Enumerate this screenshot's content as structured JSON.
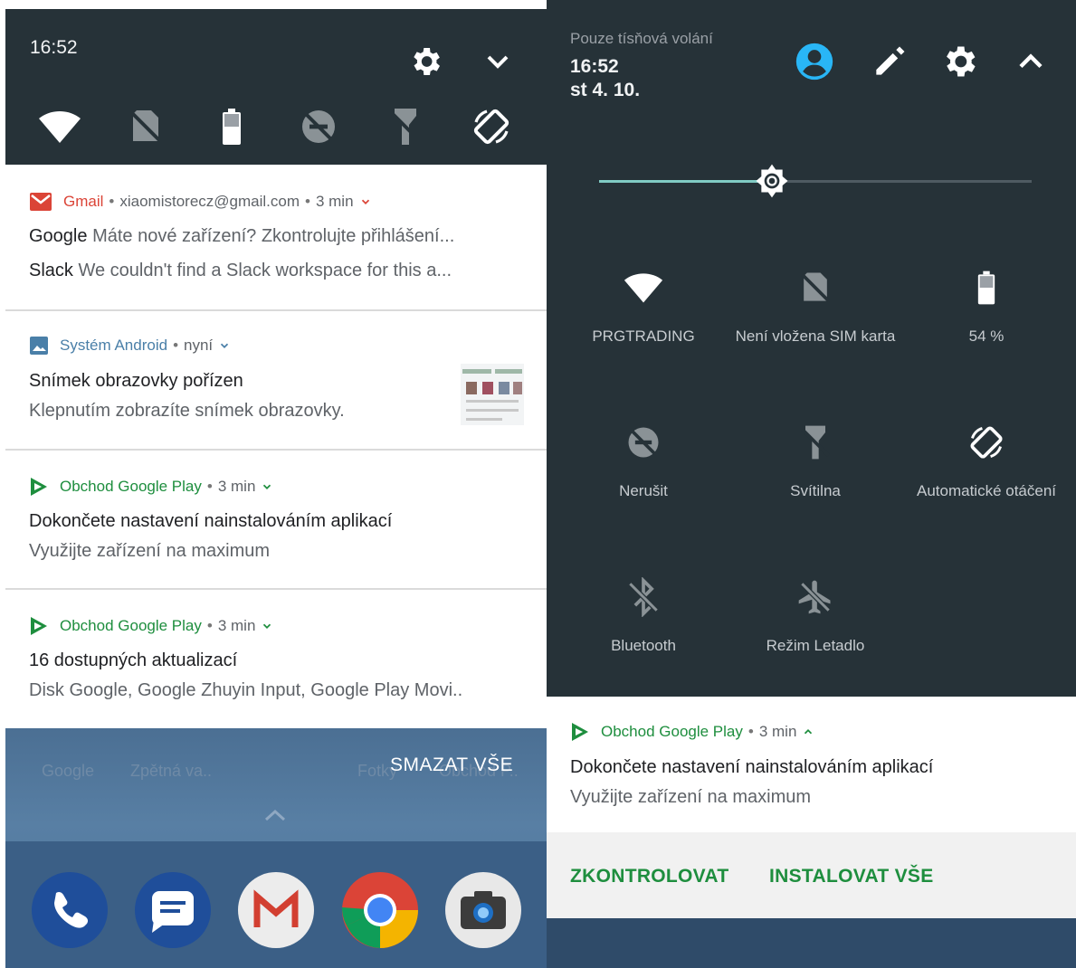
{
  "left": {
    "time": "16:52",
    "header_icons": [
      "gear-icon",
      "chevron-down-icon"
    ],
    "quick_tiles": [
      "wifi-icon",
      "no-sim-icon",
      "battery-icon",
      "dnd-icon",
      "flashlight-off-icon",
      "auto-rotate-icon"
    ],
    "notifications": [
      {
        "app": "Gmail",
        "account": "xiaomistorecz@gmail.com",
        "time": "3 min",
        "lines": [
          {
            "title": "Google",
            "text": "Máte nové zařízení? Zkontrolujte přihlášení..."
          },
          {
            "title": "Slack",
            "text": "We couldn't find a Slack workspace for this a..."
          }
        ]
      },
      {
        "app": "Systém Android",
        "time": "nyní",
        "title": "Snímek obrazovky pořízen",
        "text": "Klepnutím zobrazíte snímek obrazovky."
      },
      {
        "app": "Obchod Google Play",
        "time": "3 min",
        "title": "Dokončete nastavení nainstalováním aplikací",
        "text": "Využijte zařízení na maximum"
      },
      {
        "app": "Obchod Google Play",
        "time": "3 min",
        "title": "16 dostupných aktualizací",
        "text": "Disk Google, Google Zhuyin Input, Google Play Movi.."
      }
    ],
    "clear_all": "SMAZAT VŠE",
    "wallpaper_labels": [
      "Google",
      "Zpětná va..",
      "Fotky",
      "Obchod P.."
    ],
    "dock_icons": [
      "phone-icon",
      "messages-icon",
      "gmail-icon",
      "chrome-icon",
      "camera-icon"
    ]
  },
  "right": {
    "emergency": "Pouze tísňová volání",
    "time": "16:52",
    "date": "st 4. 10.",
    "header_icons": [
      "account-icon",
      "edit-icon",
      "gear-icon",
      "chevron-up-icon"
    ],
    "brightness": 0.4,
    "tiles": [
      {
        "icon": "wifi-icon",
        "label": "PRGTRADING"
      },
      {
        "icon": "no-sim-icon",
        "label": "Není vložena SIM karta"
      },
      {
        "icon": "battery-icon",
        "label": "54 %"
      },
      {
        "icon": "dnd-icon",
        "label": "Nerušit"
      },
      {
        "icon": "flashlight-off-icon",
        "label": "Svítilna"
      },
      {
        "icon": "auto-rotate-icon",
        "label": "Automatické otáčení"
      },
      {
        "icon": "bluetooth-off-icon",
        "label": "Bluetooth"
      },
      {
        "icon": "airplane-off-icon",
        "label": "Režim Letadlo"
      }
    ],
    "notification": {
      "app": "Obchod Google Play",
      "time": "3 min",
      "title": "Dokončete nastavení nainstalováním aplikací",
      "text": "Využijte zařízení na maximum"
    },
    "actions": [
      "ZKONTROLOVAT",
      "INSTALOVAT VŠE"
    ]
  },
  "colors": {
    "shade": "#263238",
    "gmail_red": "#db4437",
    "android_blue": "#4a7fa8",
    "play_green": "#1e8e3e",
    "accent_teal": "#80cbc4",
    "account_blue": "#29b6f6"
  }
}
